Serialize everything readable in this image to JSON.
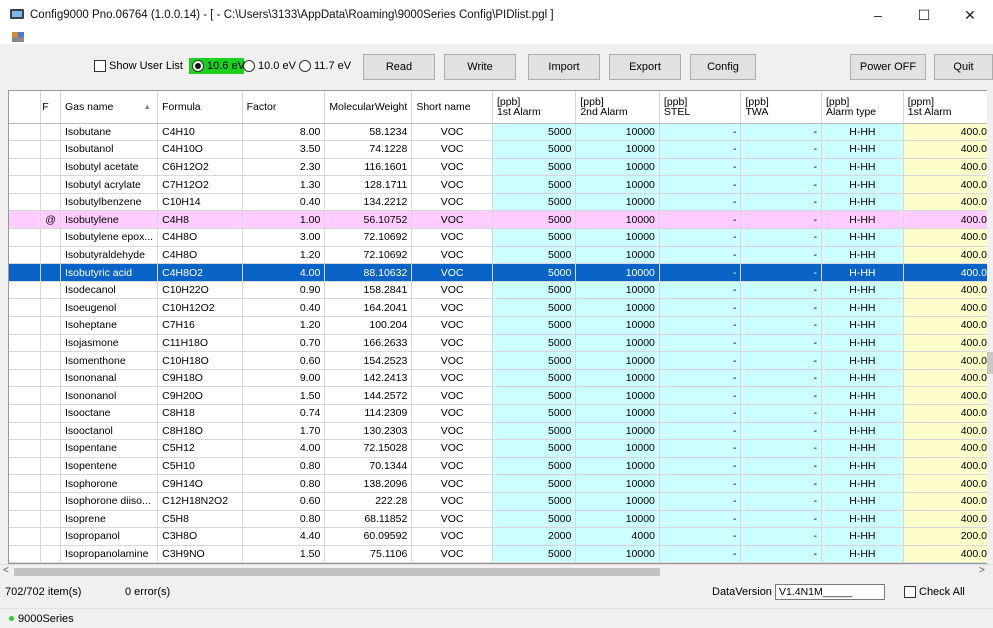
{
  "window": {
    "title": "Config9000 Pno.06764 (1.0.0.14) - [ -  C:\\Users\\3133\\AppData\\Roaming\\9000Series Config\\PIDlist.pgl ]",
    "minimize": "–",
    "maximize": "☐",
    "close": "✕"
  },
  "toolbar": {
    "show_user_list": "Show User List",
    "ev_options": [
      "10.6 eV",
      "10.0 eV",
      "11.7 eV"
    ],
    "ev_selected": "10.6 eV",
    "buttons": {
      "read": "Read",
      "write": "Write",
      "import": "Import",
      "export": "Export",
      "config": "Config",
      "power_off": "Power OFF",
      "quit": "Quit"
    }
  },
  "grid": {
    "columns": [
      "F",
      "Gas name",
      "Formula",
      "Factor",
      "MolecularWeight",
      "Short name",
      "[ppb]\n1st Alarm",
      "[ppb]\n2nd Alarm",
      "[ppb]\nSTEL",
      "[ppb]\nTWA",
      "[ppb]\nAlarm type",
      "[ppm]\n1st Alarm"
    ],
    "highlight_colors": {
      "cyan": "#ccffff",
      "yellow": "#ffffcc",
      "pink": "#ffccff",
      "selected": "#0a64c8"
    },
    "rows": [
      {
        "f": "",
        "name": "Isobutane",
        "formula": "C4H10",
        "factor": "8.00",
        "mw": "58.1234",
        "short": "VOC",
        "a1": "5000",
        "a2": "10000",
        "stel": "-",
        "twa": "-",
        "type": "H-HH",
        "ppm1": "400.0"
      },
      {
        "f": "",
        "name": "Isobutanol",
        "formula": "C4H10O",
        "factor": "3.50",
        "mw": "74.1228",
        "short": "VOC",
        "a1": "5000",
        "a2": "10000",
        "stel": "-",
        "twa": "-",
        "type": "H-HH",
        "ppm1": "400.0"
      },
      {
        "f": "",
        "name": "Isobutyl acetate",
        "formula": "C6H12O2",
        "factor": "2.30",
        "mw": "116.1601",
        "short": "VOC",
        "a1": "5000",
        "a2": "10000",
        "stel": "-",
        "twa": "-",
        "type": "H-HH",
        "ppm1": "400.0"
      },
      {
        "f": "",
        "name": "Isobutyl acrylate",
        "formula": "C7H12O2",
        "factor": "1.30",
        "mw": "128.1711",
        "short": "VOC",
        "a1": "5000",
        "a2": "10000",
        "stel": "-",
        "twa": "-",
        "type": "H-HH",
        "ppm1": "400.0"
      },
      {
        "f": "",
        "name": "Isobutylbenzene",
        "formula": "C10H14",
        "factor": "0.40",
        "mw": "134.2212",
        "short": "VOC",
        "a1": "5000",
        "a2": "10000",
        "stel": "-",
        "twa": "-",
        "type": "H-HH",
        "ppm1": "400.0"
      },
      {
        "f": "@",
        "name": "Isobutylene",
        "formula": "C4H8",
        "factor": "1.00",
        "mw": "56.10752",
        "short": "VOC",
        "a1": "5000",
        "a2": "10000",
        "stel": "-",
        "twa": "-",
        "type": "H-HH",
        "ppm1": "400.0",
        "style": "pink"
      },
      {
        "f": "",
        "name": "Isobutylene epox...",
        "formula": "C4H8O",
        "factor": "3.00",
        "mw": "72.10692",
        "short": "VOC",
        "a1": "5000",
        "a2": "10000",
        "stel": "-",
        "twa": "-",
        "type": "H-HH",
        "ppm1": "400.0"
      },
      {
        "f": "",
        "name": "Isobutyraldehyde",
        "formula": "C4H8O",
        "factor": "1.20",
        "mw": "72.10692",
        "short": "VOC",
        "a1": "5000",
        "a2": "10000",
        "stel": "-",
        "twa": "-",
        "type": "H-HH",
        "ppm1": "400.0"
      },
      {
        "f": "",
        "name": "Isobutyric acid",
        "formula": "C4H8O2",
        "factor": "4.00",
        "mw": "88.10632",
        "short": "VOC",
        "a1": "5000",
        "a2": "10000",
        "stel": "-",
        "twa": "-",
        "type": "H-HH",
        "ppm1": "400.0",
        "style": "sel"
      },
      {
        "f": "",
        "name": "Isodecanol",
        "formula": "C10H22O",
        "factor": "0.90",
        "mw": "158.2841",
        "short": "VOC",
        "a1": "5000",
        "a2": "10000",
        "stel": "-",
        "twa": "-",
        "type": "H-HH",
        "ppm1": "400.0"
      },
      {
        "f": "",
        "name": "Isoeugenol",
        "formula": "C10H12O2",
        "factor": "0.40",
        "mw": "164.2041",
        "short": "VOC",
        "a1": "5000",
        "a2": "10000",
        "stel": "-",
        "twa": "-",
        "type": "H-HH",
        "ppm1": "400.0"
      },
      {
        "f": "",
        "name": "Isoheptane",
        "formula": "C7H16",
        "factor": "1.20",
        "mw": "100.204",
        "short": "VOC",
        "a1": "5000",
        "a2": "10000",
        "stel": "-",
        "twa": "-",
        "type": "H-HH",
        "ppm1": "400.0"
      },
      {
        "f": "",
        "name": "Isojasmone",
        "formula": "C11H18O",
        "factor": "0.70",
        "mw": "166.2633",
        "short": "VOC",
        "a1": "5000",
        "a2": "10000",
        "stel": "-",
        "twa": "-",
        "type": "H-HH",
        "ppm1": "400.0"
      },
      {
        "f": "",
        "name": "Isomenthone",
        "formula": "C10H18O",
        "factor": "0.60",
        "mw": "154.2523",
        "short": "VOC",
        "a1": "5000",
        "a2": "10000",
        "stel": "-",
        "twa": "-",
        "type": "H-HH",
        "ppm1": "400.0"
      },
      {
        "f": "",
        "name": "Isononanal",
        "formula": "C9H18O",
        "factor": "9.00",
        "mw": "142.2413",
        "short": "VOC",
        "a1": "5000",
        "a2": "10000",
        "stel": "-",
        "twa": "-",
        "type": "H-HH",
        "ppm1": "400.0"
      },
      {
        "f": "",
        "name": "Isononanol",
        "formula": "C9H20O",
        "factor": "1.50",
        "mw": "144.2572",
        "short": "VOC",
        "a1": "5000",
        "a2": "10000",
        "stel": "-",
        "twa": "-",
        "type": "H-HH",
        "ppm1": "400.0"
      },
      {
        "f": "",
        "name": "Isooctane",
        "formula": "C8H18",
        "factor": "0.74",
        "mw": "114.2309",
        "short": "VOC",
        "a1": "5000",
        "a2": "10000",
        "stel": "-",
        "twa": "-",
        "type": "H-HH",
        "ppm1": "400.0"
      },
      {
        "f": "",
        "name": "Isooctanol",
        "formula": "C8H18O",
        "factor": "1.70",
        "mw": "130.2303",
        "short": "VOC",
        "a1": "5000",
        "a2": "10000",
        "stel": "-",
        "twa": "-",
        "type": "H-HH",
        "ppm1": "400.0"
      },
      {
        "f": "",
        "name": "Isopentane",
        "formula": "C5H12",
        "factor": "4.00",
        "mw": "72.15028",
        "short": "VOC",
        "a1": "5000",
        "a2": "10000",
        "stel": "-",
        "twa": "-",
        "type": "H-HH",
        "ppm1": "400.0"
      },
      {
        "f": "",
        "name": "Isopentene",
        "formula": "C5H10",
        "factor": "0.80",
        "mw": "70.1344",
        "short": "VOC",
        "a1": "5000",
        "a2": "10000",
        "stel": "-",
        "twa": "-",
        "type": "H-HH",
        "ppm1": "400.0"
      },
      {
        "f": "",
        "name": "Isophorone",
        "formula": "C9H14O",
        "factor": "0.80",
        "mw": "138.2096",
        "short": "VOC",
        "a1": "5000",
        "a2": "10000",
        "stel": "-",
        "twa": "-",
        "type": "H-HH",
        "ppm1": "400.0"
      },
      {
        "f": "",
        "name": "Isophorone diiso...",
        "formula": "C12H18N2O2",
        "factor": "0.60",
        "mw": "222.28",
        "short": "VOC",
        "a1": "5000",
        "a2": "10000",
        "stel": "-",
        "twa": "-",
        "type": "H-HH",
        "ppm1": "400.0"
      },
      {
        "f": "",
        "name": "Isoprene",
        "formula": "C5H8",
        "factor": "0.80",
        "mw": "68.11852",
        "short": "VOC",
        "a1": "5000",
        "a2": "10000",
        "stel": "-",
        "twa": "-",
        "type": "H-HH",
        "ppm1": "400.0"
      },
      {
        "f": "",
        "name": "Isopropanol",
        "formula": "C3H8O",
        "factor": "4.40",
        "mw": "60.09592",
        "short": "VOC",
        "a1": "2000",
        "a2": "4000",
        "stel": "-",
        "twa": "-",
        "type": "H-HH",
        "ppm1": "200.0"
      },
      {
        "f": "",
        "name": "Isopropanolamine",
        "formula": "C3H9NO",
        "factor": "1.50",
        "mw": "75.1106",
        "short": "VOC",
        "a1": "5000",
        "a2": "10000",
        "stel": "-",
        "twa": "-",
        "type": "H-HH",
        "ppm1": "400.0"
      }
    ]
  },
  "status": {
    "items": "702/702 item(s)",
    "errors": "0 error(s)",
    "data_version_label": "DataVersion",
    "data_version_value": "V1.4N1M_____",
    "check_all": "Check All"
  },
  "footer": {
    "label": "9000Series"
  }
}
